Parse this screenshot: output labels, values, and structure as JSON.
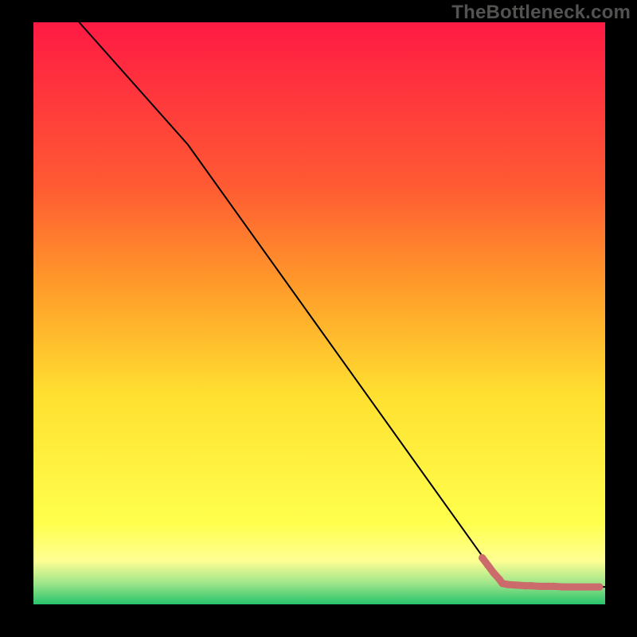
{
  "watermark": "TheBottleneck.com",
  "colors": {
    "frame": "#000000",
    "watermark": "#525251",
    "line": "#000000",
    "marker": "#cc6b6b",
    "gradient_top": "#ff1a44",
    "gradient_mid_upper": "#ff9a2a",
    "gradient_mid": "#ffe030",
    "gradient_lower": "#ffff93",
    "gradient_nearbottom": "#9be48a",
    "gradient_bottom": "#28c36b"
  },
  "chart_data": {
    "type": "line",
    "title": "",
    "xlabel": "",
    "ylabel": "",
    "xlim": [
      0,
      100
    ],
    "ylim": [
      0,
      100
    ],
    "grid": false,
    "legend": false,
    "series": [
      {
        "name": "bottleneck-curve",
        "x": [
          8,
          27,
          82,
          100
        ],
        "y": [
          100,
          79,
          3.5,
          3
        ],
        "markers": false
      },
      {
        "name": "highlight-segment",
        "x": [
          78.5,
          79.5,
          80.5,
          81.5,
          82.0,
          83.0,
          84.5,
          86.0,
          87.0,
          88.5,
          90.0,
          91.0,
          92.5,
          93.5,
          95.5,
          99.0
        ],
        "y": [
          8.0,
          6.7,
          5.4,
          4.3,
          3.6,
          3.4,
          3.3,
          3.2,
          3.2,
          3.1,
          3.1,
          3.1,
          3.0,
          3.0,
          3.0,
          3.0
        ],
        "markers": true
      }
    ]
  }
}
